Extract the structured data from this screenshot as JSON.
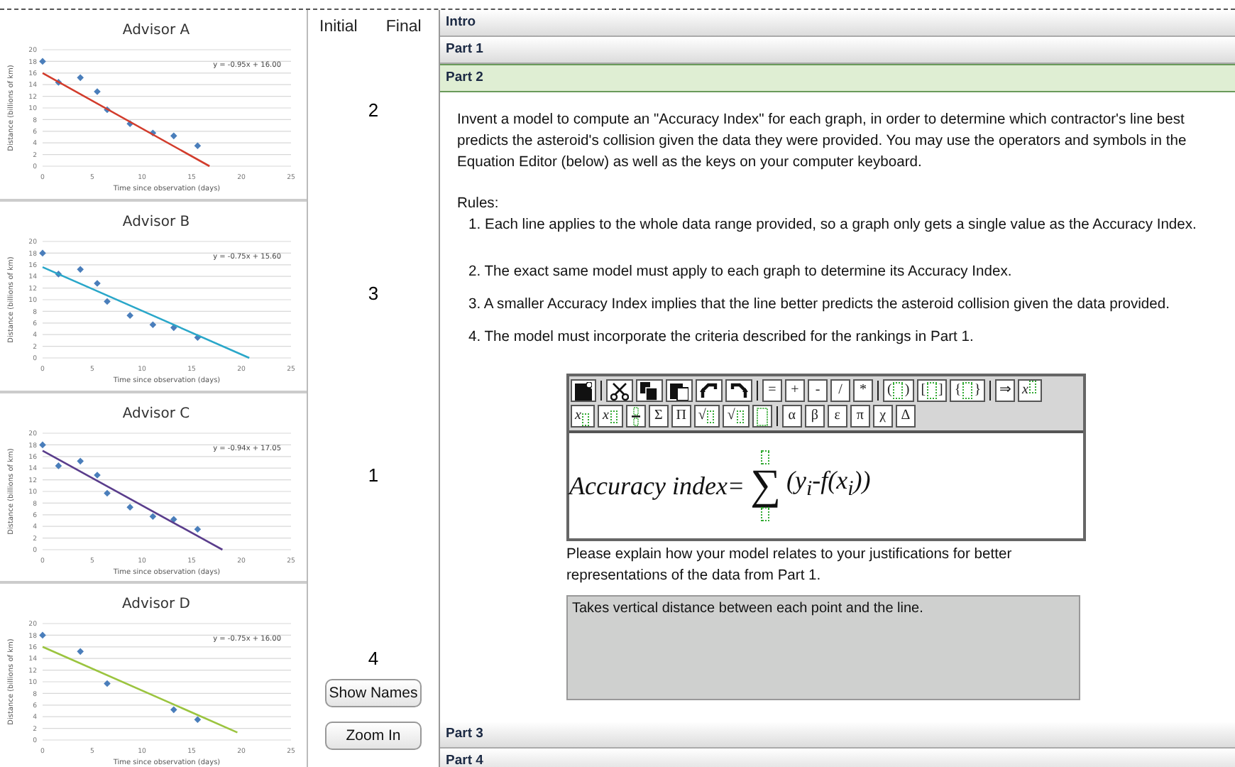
{
  "charts": [
    {
      "chart_data": {
        "type": "scatter",
        "title": "Advisor A",
        "xlabel": "Time since observation (days)",
        "ylabel": "Distance (billions of km)",
        "xlim": [
          0,
          25
        ],
        "ylim": [
          0,
          20
        ],
        "grid": true,
        "xticks": [
          0,
          5,
          10,
          15,
          20,
          25
        ],
        "yticks": [
          0,
          2,
          4,
          6,
          8,
          10,
          12,
          14,
          16,
          18,
          20
        ],
        "annotations": [
          {
            "text": "y = -0.95x + 16.00"
          }
        ],
        "series": [
          {
            "type": "scatter",
            "color": "#4a7ebb",
            "x": [
              0,
              1.6,
              3.8,
              5.5,
              6.5,
              8.8,
              11.1,
              13.2,
              15.6
            ],
            "values": [
              18,
              14.4,
              15.2,
              12.8,
              9.7,
              7.3,
              5.7,
              5.2,
              3.5
            ]
          },
          {
            "type": "line",
            "color": "#d23c2c",
            "x": [
              0,
              16.8
            ],
            "values": [
              16,
              0
            ]
          }
        ]
      }
    },
    {
      "chart_data": {
        "type": "scatter",
        "title": "Advisor B",
        "xlabel": "Time since observation (days)",
        "ylabel": "Distance (billions of km)",
        "xlim": [
          0,
          25
        ],
        "ylim": [
          0,
          20
        ],
        "grid": true,
        "xticks": [
          0,
          5,
          10,
          15,
          20,
          25
        ],
        "yticks": [
          0,
          2,
          4,
          6,
          8,
          10,
          12,
          14,
          16,
          18,
          20
        ],
        "annotations": [
          {
            "text": "y = -0.75x + 15.60"
          }
        ],
        "series": [
          {
            "type": "scatter",
            "color": "#4a7ebb",
            "x": [
              0,
              1.6,
              3.8,
              5.5,
              6.5,
              8.8,
              11.1,
              13.2,
              15.6
            ],
            "values": [
              18,
              14.4,
              15.2,
              12.8,
              9.7,
              7.3,
              5.7,
              5.2,
              3.5
            ]
          },
          {
            "type": "line",
            "color": "#2aa7c9",
            "x": [
              0,
              20.8
            ],
            "values": [
              15.6,
              0
            ]
          }
        ]
      }
    },
    {
      "chart_data": {
        "type": "scatter",
        "title": "Advisor C",
        "xlabel": "Time since observation (days)",
        "ylabel": "Distance (billions of km)",
        "xlim": [
          0,
          25
        ],
        "ylim": [
          0,
          20
        ],
        "grid": true,
        "xticks": [
          0,
          5,
          10,
          15,
          20,
          25
        ],
        "yticks": [
          0,
          2,
          4,
          6,
          8,
          10,
          12,
          14,
          16,
          18,
          20
        ],
        "annotations": [
          {
            "text": "y = -0.94x + 17.05"
          }
        ],
        "series": [
          {
            "type": "scatter",
            "color": "#4a7ebb",
            "x": [
              0,
              1.6,
              3.8,
              5.5,
              6.5,
              8.8,
              11.1,
              13.2,
              15.6
            ],
            "values": [
              18,
              14.4,
              15.2,
              12.8,
              9.7,
              7.3,
              5.7,
              5.2,
              3.5
            ]
          },
          {
            "type": "line",
            "color": "#5a3d8c",
            "x": [
              0,
              18.1
            ],
            "values": [
              17,
              0
            ]
          }
        ]
      }
    },
    {
      "chart_data": {
        "type": "scatter",
        "title": "Advisor D",
        "xlabel": "Time since observation (days)",
        "ylabel": "Distance (billions of km)",
        "xlim": [
          0,
          25
        ],
        "ylim": [
          0,
          20
        ],
        "grid": true,
        "xticks": [
          0,
          5,
          10,
          15,
          20,
          25
        ],
        "yticks": [
          0,
          2,
          4,
          6,
          8,
          10,
          12,
          14,
          16,
          18,
          20
        ],
        "annotations": [
          {
            "text": "y = -0.75x + 16.00"
          }
        ],
        "series": [
          {
            "type": "scatter",
            "color": "#4a7ebb",
            "x": [
              0,
              3.8,
              6.5,
              13.2,
              15.6
            ],
            "values": [
              18,
              15.2,
              9.7,
              5.2,
              3.5
            ]
          },
          {
            "type": "line",
            "color": "#9bc43f",
            "x": [
              0,
              19.6
            ],
            "values": [
              16,
              1.3
            ]
          }
        ]
      }
    }
  ],
  "scores": {
    "columns": [
      "Initial",
      "Final"
    ],
    "initial": [
      "2",
      "3",
      "1",
      "4"
    ]
  },
  "buttons": [
    "Show Names",
    "Zoom In"
  ],
  "sections": [
    {
      "title": "Intro",
      "expanded": false
    },
    {
      "title": "Part 1",
      "expanded": false
    },
    {
      "title": "Part 2",
      "expanded": true,
      "content": {
        "intro": "Invent a model to compute an \"Accuracy Index\" for each graph, in order to determine which contractor's line best predicts the asteroid's collision given the data they were provided. You may use the operators and symbols in the Equation Editor (below) as well as the keys on your computer keyboard.",
        "rules_heading": "Rules:",
        "rules": [
          "1. Each line applies to the whole data range provided, so a graph only gets a single value as the Accuracy Index.",
          "2. The exact same model must apply to each graph to determine its Accuracy Index.",
          "3. A smaller Accuracy Index implies that the line better predicts the asteroid collision given the data provided.",
          "4. The model must incorporate the criteria described for the rankings in Part 1."
        ],
        "toolbar": [
          [
            {
              "kind": "new"
            },
            {
              "kind": "sep"
            },
            {
              "kind": "cut"
            },
            {
              "kind": "copy"
            },
            {
              "kind": "paste"
            },
            {
              "kind": "undo"
            },
            {
              "kind": "redo"
            },
            {
              "kind": "sep"
            },
            {
              "kind": "text",
              "label": "="
            },
            {
              "kind": "text",
              "label": "+"
            },
            {
              "kind": "text",
              "label": "-"
            },
            {
              "kind": "text",
              "label": "/"
            },
            {
              "kind": "text",
              "label": "*"
            },
            {
              "kind": "sep"
            },
            {
              "kind": "wrap",
              "open": "(",
              "close": ")"
            },
            {
              "kind": "wrap",
              "open": "[",
              "close": "]"
            },
            {
              "kind": "wrap",
              "open": "{",
              "close": "}"
            },
            {
              "kind": "sep"
            },
            {
              "kind": "text",
              "label": "⇒"
            },
            {
              "kind": "sup",
              "label": "x"
            }
          ],
          [
            {
              "kind": "sub",
              "label": "x"
            },
            {
              "kind": "subsup",
              "label": "x"
            },
            {
              "kind": "frac"
            },
            {
              "kind": "text",
              "label": "Σ"
            },
            {
              "kind": "text",
              "label": "Π"
            },
            {
              "kind": "nroot",
              "label": "√"
            },
            {
              "kind": "root",
              "label": "√"
            },
            {
              "kind": "slot"
            },
            {
              "kind": "sep"
            },
            {
              "kind": "text",
              "label": "α"
            },
            {
              "kind": "text",
              "label": "β"
            },
            {
              "kind": "text",
              "label": "ε"
            },
            {
              "kind": "text",
              "label": "π"
            },
            {
              "kind": "text",
              "label": "χ"
            },
            {
              "kind": "text",
              "label": "Δ"
            }
          ]
        ],
        "equation": {
          "lhs": "Accuracy index=",
          "operator": "∑",
          "body": "(y$_{i}$-f(x$_{i}$))"
        },
        "prompt": "Please explain how your model relates to your justifications for better representations of the data from Part 1.",
        "answer": "Takes vertical distance between each point and the line."
      }
    },
    {
      "title": "Part 3",
      "expanded": false
    },
    {
      "title": "Part 4",
      "expanded": false
    }
  ]
}
